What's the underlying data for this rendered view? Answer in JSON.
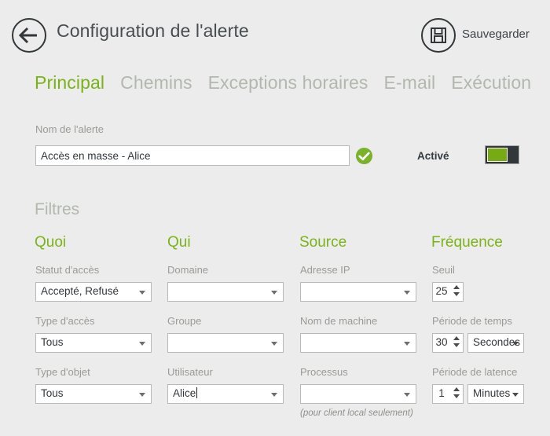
{
  "header": {
    "title": "Configuration de l'alerte",
    "back_icon": "back-arrow-icon",
    "save_icon": "floppy-disk-save-icon",
    "save_label": "Sauvegarder"
  },
  "tabs": [
    {
      "label": "Principal",
      "active": true
    },
    {
      "label": "Chemins",
      "active": false
    },
    {
      "label": "Exceptions horaires",
      "active": false
    },
    {
      "label": "E-mail",
      "active": false
    },
    {
      "label": "Exécution",
      "active": false
    }
  ],
  "alert_name": {
    "label": "Nom de l'alerte",
    "value": "Accès en masse - Alice",
    "valid_icon": "green-check-circle-icon"
  },
  "enabled": {
    "label": "Activé",
    "state": "on",
    "on_color": "#76ab13",
    "off_color": "#32383a"
  },
  "filters": {
    "title": "Filtres",
    "columns": [
      {
        "title": "Quoi",
        "fields": [
          {
            "label": "Statut d'accès",
            "value": "Accepté, Refusé",
            "type": "combo"
          },
          {
            "label": "Type d'accès",
            "value": "Tous",
            "type": "combo"
          },
          {
            "label": "Type d'objet",
            "value": "Tous",
            "type": "combo"
          }
        ]
      },
      {
        "title": "Qui",
        "fields": [
          {
            "label": "Domaine",
            "value": "",
            "type": "combo"
          },
          {
            "label": "Groupe",
            "value": "",
            "type": "combo"
          },
          {
            "label": "Utilisateur",
            "value": "Alice",
            "type": "combo",
            "focused": true
          }
        ]
      },
      {
        "title": "Source",
        "fields": [
          {
            "label": "Adresse IP",
            "value": "",
            "type": "combo"
          },
          {
            "label": "Nom de machine",
            "value": "",
            "type": "combo"
          },
          {
            "label": "Processus",
            "value": "",
            "type": "combo",
            "note": "(pour client local seulement)"
          }
        ]
      },
      {
        "title": "Fréquence",
        "fields": [
          {
            "label": "Seuil",
            "value": "25",
            "type": "spinner"
          },
          {
            "label": "Période de temps",
            "value": "30",
            "type": "spinner",
            "unit": "Secondes"
          },
          {
            "label": "Période de latence",
            "value": "1",
            "type": "spinner",
            "unit": "Minutes"
          }
        ]
      }
    ]
  },
  "theme": {
    "accent_green": "#7ab317",
    "muted_green": "#b3b8ae",
    "background": "#ececec",
    "label_gray": "#9a9a96",
    "text_dark": "#33383c"
  }
}
